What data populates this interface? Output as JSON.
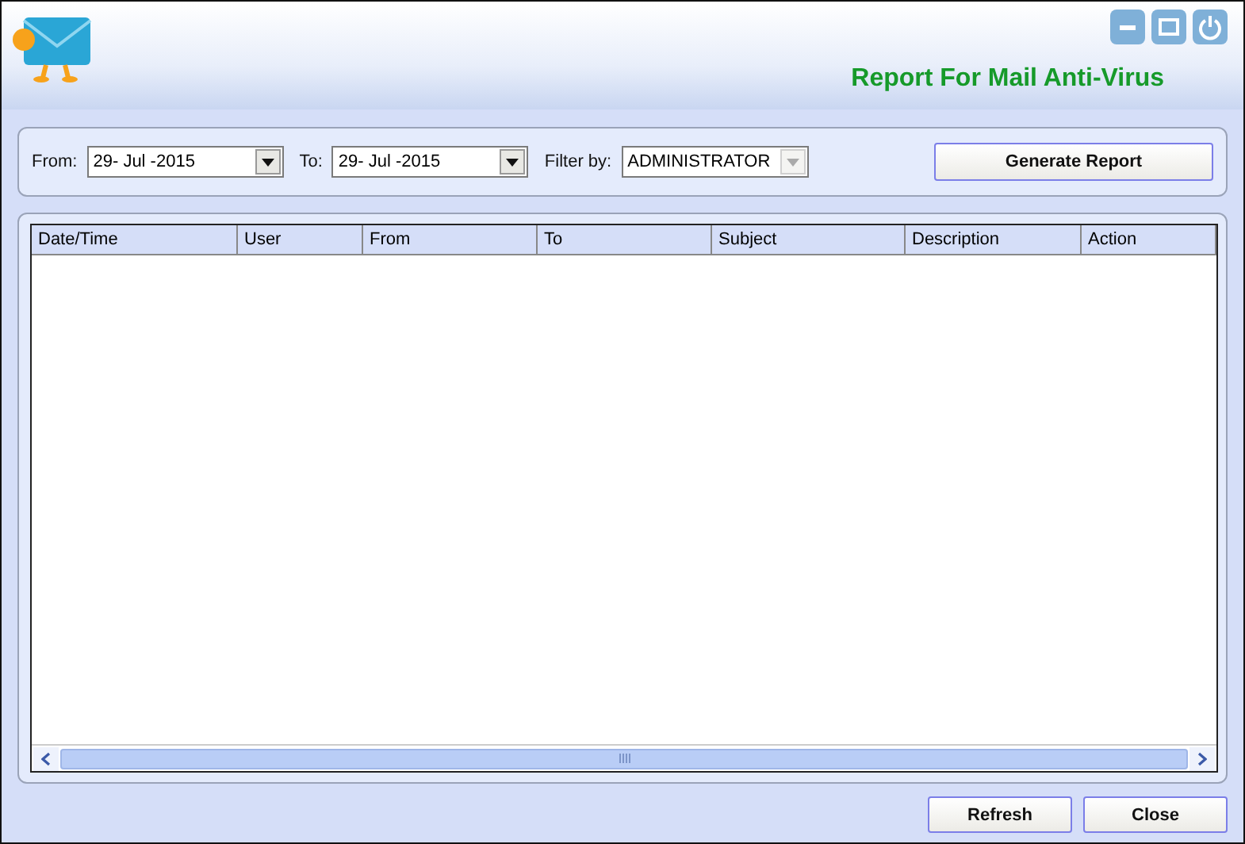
{
  "window": {
    "title": "Report For Mail Anti-Virus"
  },
  "filters": [
    {
      "label": "From:",
      "value": "29- Jul -2015",
      "disabled": false
    },
    {
      "label": "To:",
      "value": "29- Jul -2015",
      "disabled": false
    },
    {
      "label": "Filter by:",
      "value": "ADMINISTRATOR",
      "disabled": true
    }
  ],
  "generate_button": "Generate Report",
  "table": {
    "columns": [
      "Date/Time",
      "User",
      "From",
      "To",
      "Subject",
      "Description",
      "Action"
    ]
  },
  "buttons": [
    "Refresh",
    "Close"
  ]
}
